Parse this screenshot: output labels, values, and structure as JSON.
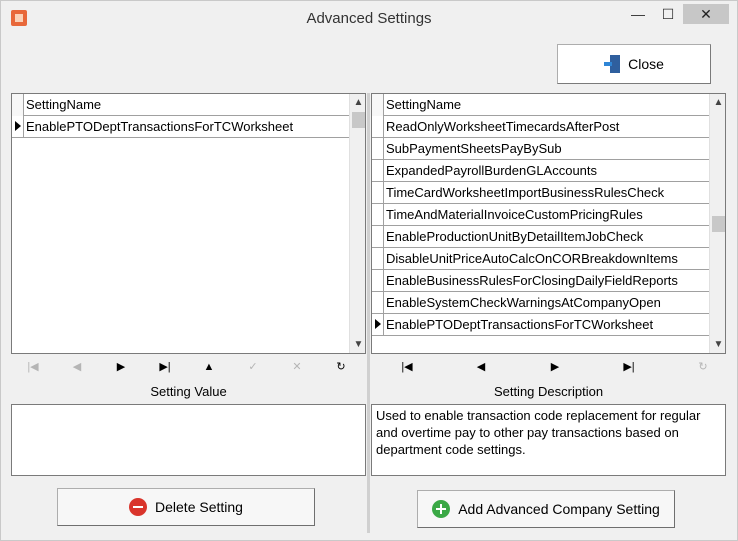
{
  "window": {
    "title": "Advanced Settings",
    "controls": {
      "minimize": "—",
      "maximize": "☐",
      "close": "✕"
    }
  },
  "toolbar": {
    "close_label": "Close"
  },
  "left_grid": {
    "column": "SettingName",
    "rows": [
      {
        "name": "EnablePTODeptTransactionsForTCWorksheet",
        "current": true
      }
    ]
  },
  "right_grid": {
    "column": "SettingName",
    "rows": [
      {
        "name": "ReadOnlyWorksheetTimecardsAfterPost",
        "current": false
      },
      {
        "name": "SubPaymentSheetsPayBySub",
        "current": false
      },
      {
        "name": "ExpandedPayrollBurdenGLAccounts",
        "current": false
      },
      {
        "name": "TimeCardWorksheetImportBusinessRulesCheck",
        "current": false
      },
      {
        "name": "TimeAndMaterialInvoiceCustomPricingRules",
        "current": false
      },
      {
        "name": "EnableProductionUnitByDetailItemJobCheck",
        "current": false
      },
      {
        "name": "DisableUnitPriceAutoCalcOnCORBreakdownItems",
        "current": false
      },
      {
        "name": "EnableBusinessRulesForClosingDailyFieldReports",
        "current": false
      },
      {
        "name": "EnableSystemCheckWarningsAtCompanyOpen",
        "current": false
      },
      {
        "name": "EnablePTODeptTransactionsForTCWorksheet",
        "current": true
      }
    ]
  },
  "left_nav": {
    "buttons": [
      {
        "name": "first-record-button",
        "glyph": "|◀",
        "enabled": false
      },
      {
        "name": "previous-record-button",
        "glyph": "◀",
        "enabled": false
      },
      {
        "name": "next-record-button",
        "glyph": "▶",
        "enabled": true
      },
      {
        "name": "last-record-button",
        "glyph": "▶|",
        "enabled": true
      },
      {
        "name": "insert-record-button",
        "glyph": "▲",
        "enabled": true
      },
      {
        "name": "post-edit-button",
        "glyph": "✓",
        "enabled": false
      },
      {
        "name": "cancel-edit-button",
        "glyph": "✕",
        "enabled": false
      },
      {
        "name": "refresh-button",
        "glyph": "↻",
        "enabled": true
      }
    ]
  },
  "right_nav": {
    "buttons": [
      {
        "name": "first-record-button",
        "glyph": "|◀",
        "enabled": true
      },
      {
        "name": "previous-record-button",
        "glyph": "◀",
        "enabled": true
      },
      {
        "name": "next-record-button",
        "glyph": "▶",
        "enabled": true
      },
      {
        "name": "last-record-button",
        "glyph": "▶|",
        "enabled": true
      },
      {
        "name": "refresh-button",
        "glyph": "↻",
        "enabled": false
      }
    ]
  },
  "setting_value": {
    "label": "Setting Value",
    "value": ""
  },
  "setting_description": {
    "label": "Setting Description",
    "text": "Used to enable transaction code replacement for regular and overtime pay to other pay transactions based on department code settings."
  },
  "actions": {
    "delete_label": "Delete Setting",
    "add_label": "Add Advanced Company Setting"
  }
}
